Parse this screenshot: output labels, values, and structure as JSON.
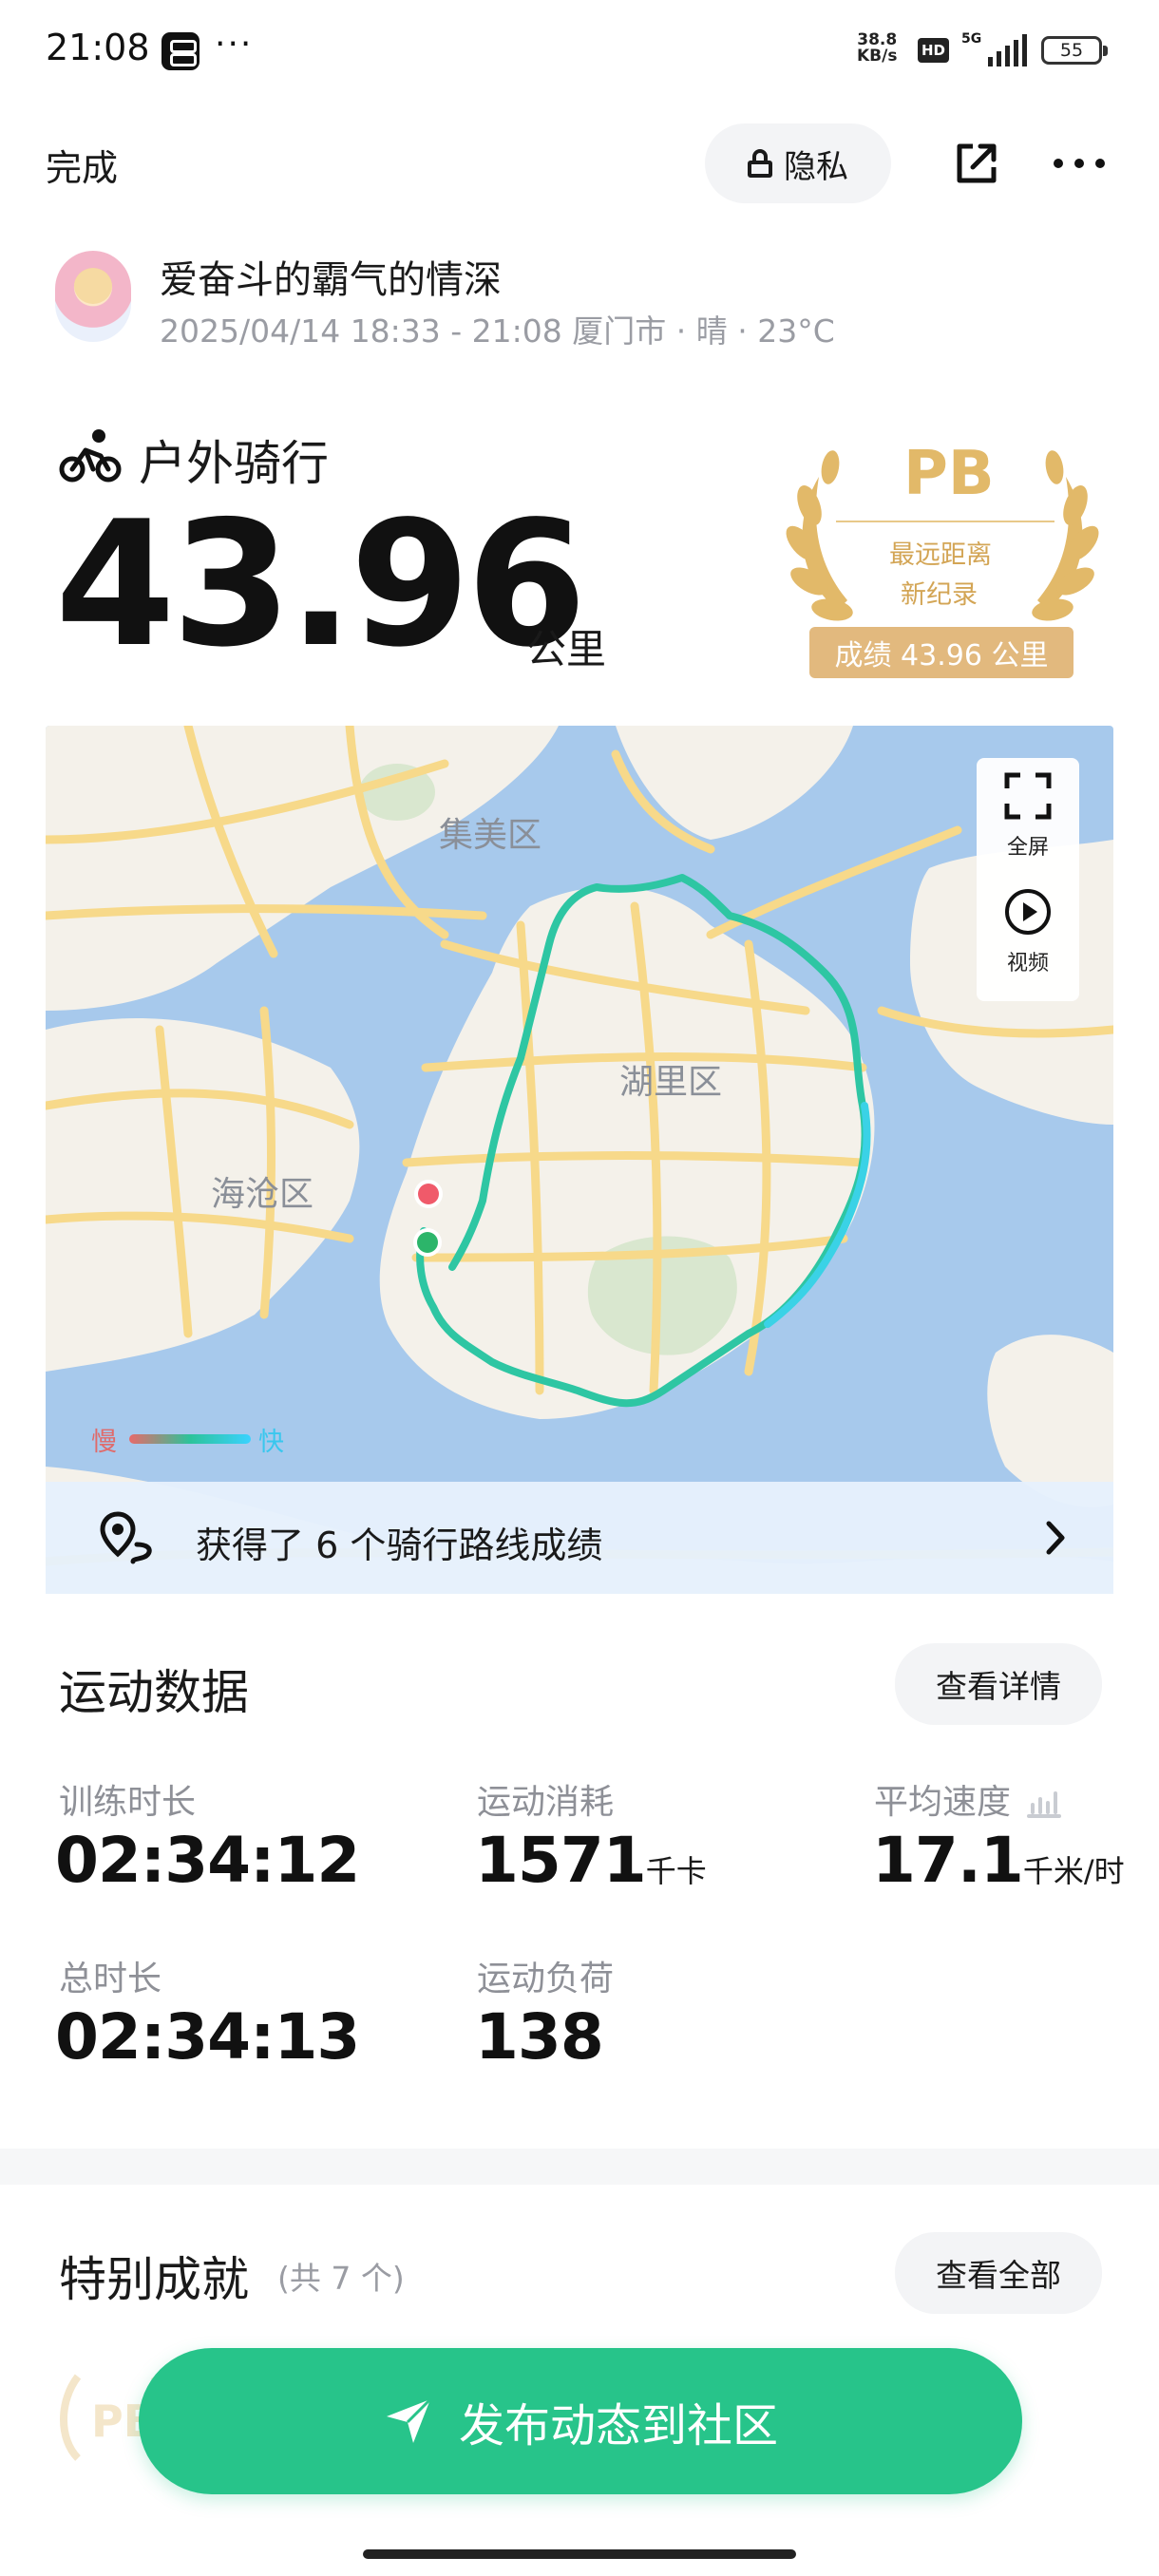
{
  "status_bar": {
    "time": "21:08",
    "dots": "···",
    "net_speed_value": "38.8",
    "net_speed_unit": "KB/s",
    "hd_badge": "HD",
    "network": "5G",
    "battery": "55"
  },
  "header": {
    "done_label": "完成",
    "privacy_label": "隐私"
  },
  "user": {
    "name": "爱奋斗的霸气的情深",
    "meta": "2025/04/14 18:33 - 21:08 厦门市 · 晴 · 23°C"
  },
  "activity": {
    "type": "户外骑行",
    "distance": "43.96",
    "distance_unit": "公里"
  },
  "pb_badge": {
    "title": "PB",
    "line1": "最远距离",
    "line2": "新纪录",
    "score": "成绩 43.96 公里",
    "color": "#e2b969"
  },
  "map": {
    "labels": {
      "jimei": "集美区",
      "huli": "湖里区",
      "haicang": "海沧区"
    },
    "fullscreen_label": "全屏",
    "video_label": "视频",
    "legend_slow": "慢",
    "legend_fast": "快",
    "route_banner_text": "获得了 6 个骑行路线成绩",
    "start_marker_color": "#2cb56a",
    "end_marker_color": "#f05a6a"
  },
  "sport_data": {
    "title": "运动数据",
    "detail_button": "查看详情",
    "stats": [
      {
        "label": "训练时长",
        "value": "02:34:12",
        "unit": ""
      },
      {
        "label": "运动消耗",
        "value": "1571",
        "unit": "千卡"
      },
      {
        "label": "平均速度",
        "value": "17.1",
        "unit": "千米/时"
      },
      {
        "label": "总时长",
        "value": "02:34:13",
        "unit": ""
      },
      {
        "label": "运动负荷",
        "value": "138",
        "unit": ""
      }
    ]
  },
  "achievements": {
    "title": "特别成就",
    "count_hint": "(共 7 个)",
    "view_all_button": "查看全部",
    "faint_badge_text": "PB"
  },
  "publish": {
    "label": "发布动态到社区",
    "color": "#27c48a"
  }
}
